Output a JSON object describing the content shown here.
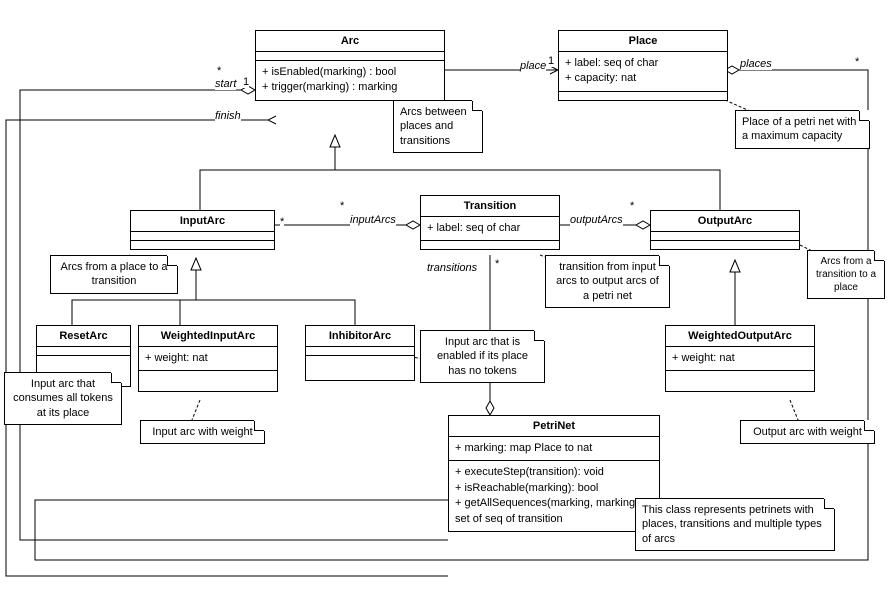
{
  "classes": {
    "arc": {
      "name": "Arc",
      "ops": [
        "+ isEnabled(marking) : bool",
        "+ trigger(marking) : marking"
      ]
    },
    "place": {
      "name": "Place",
      "attrs": [
        "+ label: seq of char",
        "+ capacity: nat"
      ]
    },
    "inputArc": {
      "name": "InputArc"
    },
    "outputArc": {
      "name": "OutputArc"
    },
    "transition": {
      "name": "Transition",
      "attrs": [
        "+ label: seq of char"
      ]
    },
    "resetArc": {
      "name": "ResetArc"
    },
    "weightedInputArc": {
      "name": "WeightedInputArc",
      "attrs": [
        "+ weight: nat"
      ]
    },
    "inhibitorArc": {
      "name": "InhibitorArc"
    },
    "weightedOutputArc": {
      "name": "WeightedOutputArc",
      "attrs": [
        "+ weight: nat"
      ]
    },
    "petriNet": {
      "name": "PetriNet",
      "attrs": [
        "+ marking: map Place to nat"
      ],
      "ops": [
        "+ executeStep(transition): void",
        "+ isReachable(marking): bool",
        "+ getAllSequences(marking, marking) : set of seq of transition"
      ]
    }
  },
  "notes": {
    "arcNote": "Arcs between places and transitions",
    "placeNote": "Place of a petri net with a maximum capacity",
    "inputArcNote": "Arcs from a place to a transition",
    "outputArcNote": "Arcs from a transition to a place",
    "transitionNote": "transition from input arcs to output arcs of a petri net",
    "resetArcNote": "Input arc that consumes all tokens at its place",
    "weightedInputArcNote": "Input arc with weight",
    "inhibitorArcNote": "Input arc that is enabled if its place has no tokens",
    "weightedOutputArcNote": "Output arc with weight",
    "petriNetNote": "This class represents petrinets with places, transitions and multiple types of arcs"
  },
  "assoc": {
    "place": "place",
    "places": "places",
    "start": "start",
    "finish": "finish",
    "inputArcs": "inputArcs",
    "outputArcs": "outputArcs",
    "transitions": "transitions"
  },
  "mult": {
    "one": "1",
    "many": "*"
  }
}
